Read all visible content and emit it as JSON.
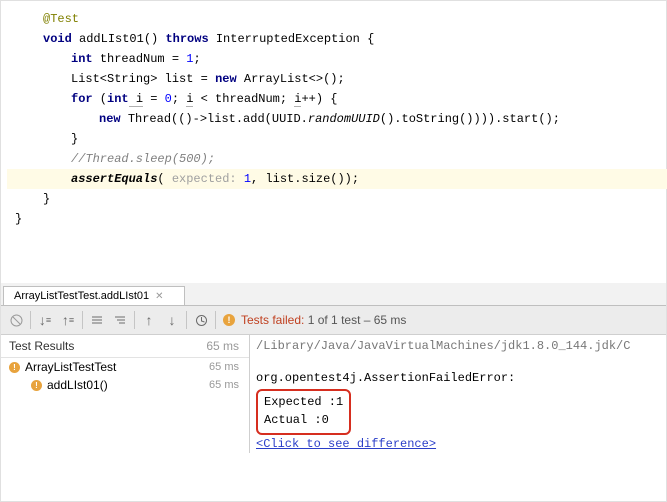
{
  "editor": {
    "annotation": "@Test",
    "method_signature": {
      "kw_void": "void",
      "name": "addLIst01",
      "kw_throws": "throws",
      "exception": "InterruptedException"
    },
    "line_threadnum": {
      "kw_int": "int",
      "var": "threadNum",
      "eq": " = ",
      "val": "1",
      "semi": ";"
    },
    "line_list": {
      "type1": "List<",
      "gen": "String",
      "type2": "> ",
      "var": "list",
      "eq": " = ",
      "kw_new": "new",
      "cls": " ArrayList<>();"
    },
    "line_for": {
      "kw_for": "for",
      "open": " (",
      "kw_int": "int",
      "var": " i",
      "eq": " = ",
      "z": "0",
      "sc": "; ",
      "cond_var": "i",
      "cond": " < threadNum; ",
      "inc_var": "i",
      "inc": "++) {"
    },
    "line_thread": {
      "kw_new": "new",
      "sp": " ",
      "cls": "Thread",
      "args1": "(()->",
      "list": "list",
      "m1": ".add(UUID.",
      "m2": "randomUUID",
      "m3": "().toString()))).start();"
    },
    "brace_close3": "}",
    "comment": "//Thread.sleep(500);",
    "line_assert": {
      "call": "assertEquals",
      "open": "(",
      "hint": " expected: ",
      "one": "1",
      "comma": ", ",
      "list": "list",
      "rest": ".size());"
    },
    "brace_close2": "}",
    "brace_outer": "}"
  },
  "tab": {
    "label": "ArrayListTestTest.addLIst01"
  },
  "toolbar_status": {
    "prefix": "Tests failed:",
    "count": " 1 of 1 test – 65 ms"
  },
  "tree": {
    "header": {
      "label": "Test Results",
      "time": "65 ms"
    },
    "rows": [
      {
        "label": "ArrayListTestTest",
        "time": "65 ms"
      },
      {
        "label": "addLIst01()",
        "time": "65 ms"
      }
    ]
  },
  "console": {
    "path": "/Library/Java/JavaVirtualMachines/jdk1.8.0_144.jdk/C",
    "error_line": "org.opentest4j.AssertionFailedError:",
    "expected": "Expected :1",
    "actual": "Actual   :0",
    "link": "<Click to see difference>"
  }
}
